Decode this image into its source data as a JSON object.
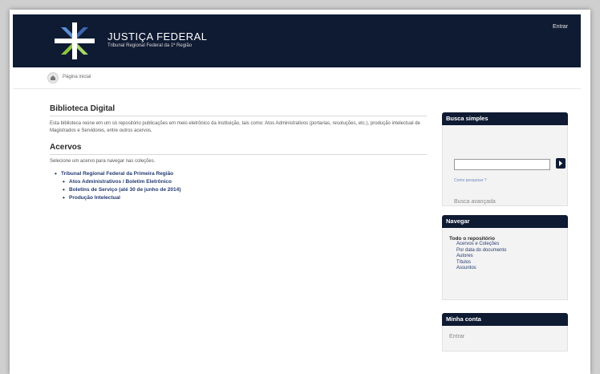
{
  "header": {
    "title": "JUSTIÇA FEDERAL",
    "subtitle": "Tribunal Regional Federal da 1ª Região",
    "login": "Entrar"
  },
  "trail": {
    "home": "Página inicial"
  },
  "main": {
    "heading": "Biblioteca Digital",
    "intro": "Esta biblioteca reúne em um só repositório publicações em meio eletrônico da instituição, tais como: Atos Administrativos (portarias, resoluções, etc.), produção intelectual de Magistrados e Servidores, entre outros acervos.",
    "collections_heading": "Acervos",
    "prompt": "Selecione um acervo para navegar nas coleções.",
    "tree": {
      "root": "Tribunal Regional Federal da Primeira Região",
      "children": [
        "Atos Administrativos / Boletim Eletrônico",
        "Boletins de Serviço (até 30 de junho de 2014)",
        "Produção Intelectual"
      ]
    }
  },
  "sidebar": {
    "search": {
      "title": "Busca simples",
      "input_value": "",
      "go_icon": "chevron-right-icon",
      "help_link": "Como pesquisar ?",
      "advanced_link": "Busca avançada"
    },
    "browse": {
      "title": "Navegar",
      "section": "Todo o repositório",
      "links": [
        "Acervos e Coleções",
        "Por data do documento",
        "Autores",
        "Títulos",
        "Assuntos"
      ]
    },
    "account": {
      "title": "Minha conta",
      "login": "Entrar"
    }
  },
  "colors": {
    "header_bg": "#0f1b33",
    "link": "#243a72",
    "logo_green": "#8dc63f",
    "logo_blue": "#3a67b1"
  }
}
